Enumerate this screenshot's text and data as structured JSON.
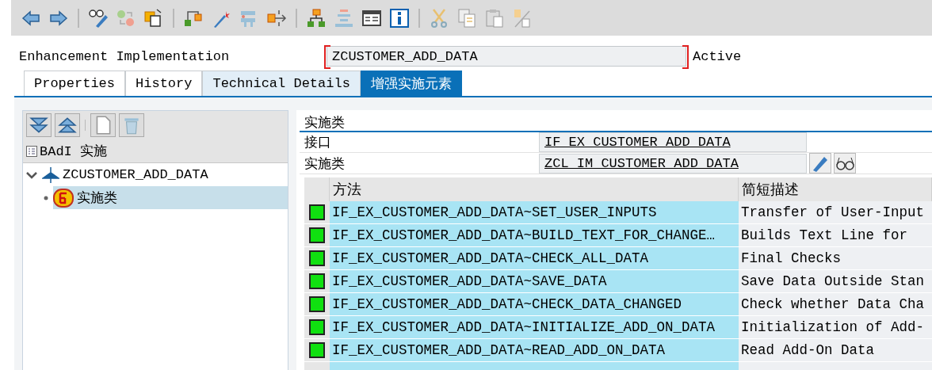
{
  "header": {
    "label": "Enhancement Implementation",
    "value": "ZCUSTOMER_ADD_DATA",
    "status": "Active"
  },
  "tabs": [
    {
      "label": "Properties",
      "selected": false,
      "highlighted": false
    },
    {
      "label": "History",
      "selected": false,
      "highlighted": false
    },
    {
      "label": "Technical Details",
      "selected": false,
      "highlighted": true
    },
    {
      "label": "增强实施元素",
      "selected": true
    }
  ],
  "tree": {
    "header": "BAdI 实施",
    "items": [
      {
        "label": "ZCUSTOMER_ADD_DATA",
        "expanded": true,
        "selected": false,
        "children": [
          {
            "label": "实施类",
            "selected": true
          }
        ]
      }
    ]
  },
  "detail": {
    "title": "实施类",
    "fields": [
      {
        "label": "接口",
        "value": "IF_EX_CUSTOMER_ADD_DATA"
      },
      {
        "label": "实施类",
        "value": "ZCL_IM_CUSTOMER_ADD_DATA"
      }
    ],
    "table": {
      "columns": [
        "方法",
        "简短描述"
      ],
      "rows": [
        {
          "method": "IF_EX_CUSTOMER_ADD_DATA~SET_USER_INPUTS",
          "description": "Transfer of User-Input"
        },
        {
          "method": "IF_EX_CUSTOMER_ADD_DATA~BUILD_TEXT_FOR_CHANGE…",
          "description": "Builds Text Line for"
        },
        {
          "method": "IF_EX_CUSTOMER_ADD_DATA~CHECK_ALL_DATA",
          "description": "Final Checks"
        },
        {
          "method": "IF_EX_CUSTOMER_ADD_DATA~SAVE_DATA",
          "description": "Save Data Outside Stan"
        },
        {
          "method": "IF_EX_CUSTOMER_ADD_DATA~CHECK_DATA_CHANGED",
          "description": "Check whether Data Cha"
        },
        {
          "method": "IF_EX_CUSTOMER_ADD_DATA~INITIALIZE_ADD_ON_DATA",
          "description": "Initialization of Add-"
        },
        {
          "method": "IF_EX_CUSTOMER_ADD_DATA~READ_ADD_ON_DATA",
          "description": "Read Add-On Data"
        }
      ]
    }
  }
}
